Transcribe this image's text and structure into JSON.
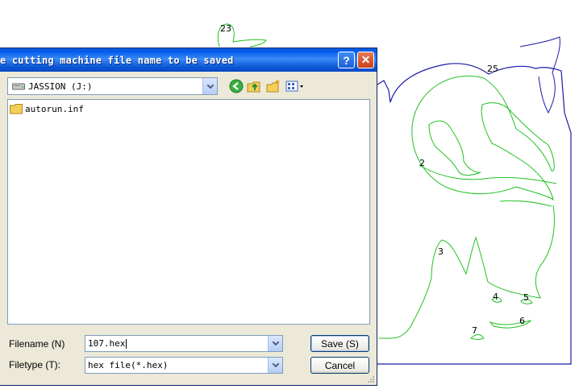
{
  "window": {
    "title": "e cutting machine file name to be saved",
    "help_label": "?",
    "close_label": "✕"
  },
  "location": {
    "drive_label": "JASSION (J:)",
    "icons": [
      "drive-icon",
      "back-icon",
      "up-folder-icon",
      "new-folder-icon",
      "view-menu-icon"
    ]
  },
  "files": [
    {
      "name": "autorun.inf",
      "icon": "folder-icon"
    }
  ],
  "form": {
    "filename_label": "Filename (N)",
    "filename_value": "107.hex",
    "filetype_label": "Filetype (T):",
    "filetype_value": "hex file(*.hex)",
    "save_label": "Save (S)",
    "cancel_label": "Cancel"
  },
  "canvas": {
    "labels": [
      "23",
      "25",
      "2",
      "3",
      "4",
      "5",
      "6",
      "7"
    ],
    "outline_color": "#1a1aa8",
    "cut_color": "#22c022"
  }
}
